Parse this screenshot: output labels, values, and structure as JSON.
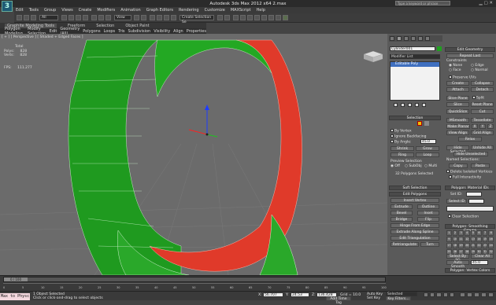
{
  "app": {
    "title": "Autodesk 3ds Max 2012 x64    2.max",
    "search_placeholder": "Type a keyword or phrase",
    "logo_letter": "3",
    "brand_color": "#1e5a74"
  },
  "menu": [
    "Edit",
    "Tools",
    "Group",
    "Views",
    "Create",
    "Modifiers",
    "Animation",
    "Graph Editors",
    "Rendering",
    "Customize",
    "MAXScript",
    "Help"
  ],
  "toolbar": {
    "selection_filter": "All",
    "ref_coord": "View",
    "named_selection": "Create Selection Se"
  },
  "ribbon": {
    "tabs": [
      "Graphite Modeling Tools",
      "Freeform",
      "Selection",
      "Object Paint"
    ],
    "menu": [
      "Polygon Modeling",
      "Modify Selection",
      "Edit",
      "Geometry (All)",
      "Polygons",
      "Loops",
      "Tris",
      "Subdivision",
      "Visibility",
      "Align",
      "Properties"
    ]
  },
  "viewport": {
    "label": "[ + ] [ Perspective ] [ Shaded + Edged Faces ]",
    "stats": {
      "header": "Total",
      "polys_label": "Polys:",
      "polys_value": "828",
      "verts_label": "Verts:",
      "verts_value": "828",
      "fps_label": "FPS:",
      "fps_value": "111.277"
    },
    "colors": {
      "background": "#6b6b6b",
      "mesh_green": "#1f9a1f",
      "mesh_red": "#e03a2a"
    }
  },
  "command_panel": {
    "object_name": "Cylinder001",
    "modifier_list": "Modifier List",
    "stack_item": "Editable Poly",
    "selection_head": "Selection",
    "by_vertex": "By Vertex",
    "ignore_backfacing": "Ignore Backfacing",
    "by_angle": "By Angle:",
    "by_angle_value": "45.0",
    "shrink": "Shrink",
    "grow": "Grow",
    "ring": "Ring",
    "loop": "Loop",
    "preview_selection": "Preview Selection",
    "preview_off": "Off",
    "preview_subobj": "SubObj",
    "preview_multi": "Multi",
    "selected_count": "32 Polygons Selected",
    "soft_selection": "Soft Selection",
    "edit_polygons": "Edit Polygons",
    "insert_vertex": "Insert Vertex",
    "extrude": "Extrude",
    "outline": "Outline",
    "bevel": "Bevel",
    "inset": "Inset",
    "bridge": "Bridge",
    "flip": "Flip",
    "hinge": "Hinge From Edge",
    "extrude_spline": "Extrude Along Spline",
    "edit_triangulation": "Edit Triangulation",
    "retriangulate": "Retriangulate",
    "turn": "Turn"
  },
  "right_panel": {
    "edit_geometry": "Edit Geometry",
    "repeat_last": "Repeat Last",
    "constraints": "Constraints",
    "c_none": "None",
    "c_edge": "Edge",
    "c_face": "Face",
    "c_normal": "Normal",
    "preserve_uvs": "Preserve UVs",
    "create": "Create",
    "collapse": "Collapse",
    "attach": "Attach",
    "detach": "Detach",
    "slice_plane": "Slice Plane",
    "split": "Split",
    "slice": "Slice",
    "reset_plane": "Reset Plane",
    "quickslice": "QuickSlice",
    "cut": "Cut",
    "msmooth": "MSmooth",
    "tessellate": "Tessellate",
    "make_planar": "Make Planar",
    "x": "X",
    "y": "Y",
    "z": "Z",
    "view_align": "View Align",
    "grid_align": "Grid Align",
    "relax": "Relax",
    "hide_selected": "Hide Selected",
    "unhide_all": "Unhide All",
    "hide_unselected": "Hide Unselected",
    "named_selections": "Named Selections:",
    "copy": "Copy",
    "paste": "Paste",
    "delete_isolated": "Delete Isolated Vertices",
    "full_interactivity": "Full Interactivity",
    "material_ids": "Polygon: Material IDs",
    "set_id": "Set ID:",
    "select_id": "Select ID",
    "clear_selection": "Clear Selection",
    "smoothing_groups": "Polygon: Smoothing Groups",
    "smoothing_numbers": [
      "1",
      "2",
      "3",
      "4",
      "5",
      "6",
      "7",
      "8",
      "9",
      "10",
      "11",
      "12",
      "13",
      "14",
      "15",
      "16",
      "17",
      "18",
      "19",
      "20",
      "21",
      "22",
      "23",
      "24",
      "25",
      "26",
      "27",
      "28",
      "29",
      "30",
      "31",
      "32"
    ],
    "select_by_sg": "Select By SG",
    "clear_all": "Clear All",
    "auto_smooth": "Auto Smooth",
    "auto_smooth_value": "45.0",
    "vertex_colors": "Polygon: Vertex Colors",
    "color_label": "Color:"
  },
  "timeline": {
    "frame": "0 / 100",
    "ticks": [
      "0",
      "5",
      "10",
      "15",
      "20",
      "25",
      "30",
      "35",
      "40",
      "45",
      "50",
      "55",
      "60",
      "65",
      "70",
      "75",
      "80",
      "85",
      "90",
      "95",
      "100"
    ]
  },
  "status": {
    "maxscript": "Max to Physc",
    "objects_selected": "1 Object Selected",
    "prompt": "Click or click-and-drag to select objects",
    "x_label": "X:",
    "x_value": "56.707",
    "y_label": "Y:",
    "y_value": "24.53",
    "z_label": "Z:",
    "z_value": "136.428",
    "grid": "Grid = 10.0",
    "auto_key": "Auto Key",
    "selected": "Selected",
    "set_key": "Set Key",
    "key_filters": "Key Filters...",
    "add_time_tag": "Add Time Tag"
  }
}
